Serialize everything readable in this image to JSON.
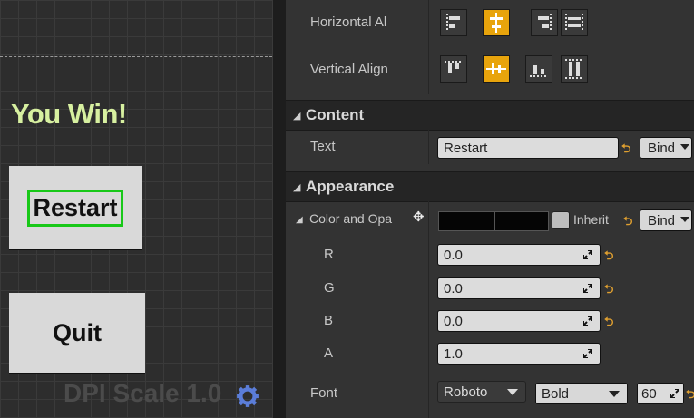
{
  "viewport": {
    "win_text": "You Win!",
    "restart_label": "Restart",
    "quit_label": "Quit",
    "dpi_label": "DPI Scale 1.0"
  },
  "alignment": {
    "horizontal_label": "Horizontal Al",
    "vertical_label": "Vertical Align"
  },
  "content": {
    "section_title": "Content",
    "text_label": "Text",
    "text_value": "Restart",
    "bind_label": "Bind"
  },
  "appearance": {
    "section_title": "Appearance",
    "color_label": "Color and Opa",
    "inherit_label": "Inherit",
    "bind_label": "Bind",
    "channels": [
      {
        "label": "R",
        "value": "0.0"
      },
      {
        "label": "G",
        "value": "0.0"
      },
      {
        "label": "B",
        "value": "0.0"
      },
      {
        "label": "A",
        "value": "1.0"
      }
    ],
    "font_label": "Font",
    "font_family": "Roboto",
    "font_style": "Bold",
    "font_size": "60"
  },
  "colors": {
    "accent": "#e8a40c",
    "highlight": "#18c818",
    "win_text": "#d7f0a0"
  }
}
